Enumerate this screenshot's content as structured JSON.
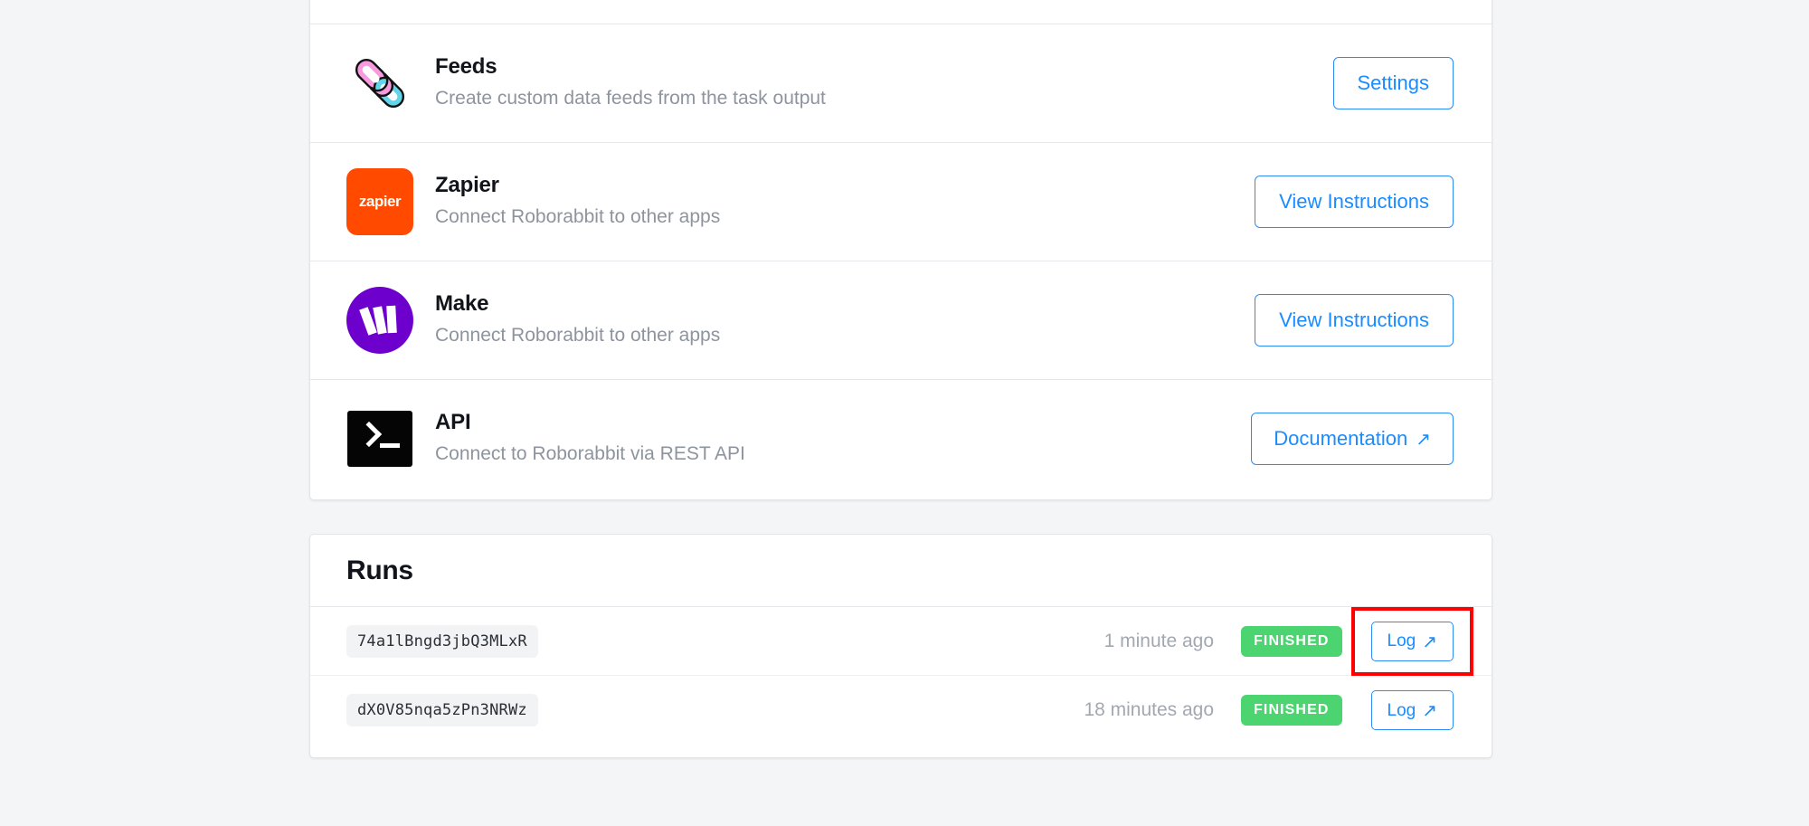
{
  "theme": {
    "page_bg": "#f4f5f7",
    "card_bg": "#ffffff",
    "accent_blue": "#1a8cff",
    "status_green": "#4cd471",
    "highlight_red": "#fe0000",
    "muted_text": "#8e949e"
  },
  "integrations": {
    "rows": [
      {
        "name": "Feeds",
        "description": "Create custom data feeds from the task output",
        "icon": "chain-link-icon",
        "action_label": "Settings",
        "external": false
      },
      {
        "name": "Zapier",
        "description": "Connect Roborabbit to other apps",
        "icon": "zapier-logo",
        "icon_text": "zapier",
        "action_label": "View Instructions",
        "external": false
      },
      {
        "name": "Make",
        "description": "Connect Roborabbit to other apps",
        "icon": "make-logo",
        "action_label": "View Instructions",
        "external": false
      },
      {
        "name": "API",
        "description": "Connect to Roborabbit via REST API",
        "icon": "terminal-icon",
        "action_label": "Documentation",
        "external": true,
        "external_glyph": "↗"
      }
    ]
  },
  "runs": {
    "title": "Runs",
    "log_glyph": "↗",
    "rows": [
      {
        "id": "74a1lBngd3jbQ3MLxR",
        "time": "1 minute ago",
        "status": "FINISHED",
        "log_label": "Log",
        "highlighted": true
      },
      {
        "id": "dX0V85nqa5zPn3NRWz",
        "time": "18 minutes ago",
        "status": "FINISHED",
        "log_label": "Log",
        "highlighted": false
      }
    ]
  }
}
